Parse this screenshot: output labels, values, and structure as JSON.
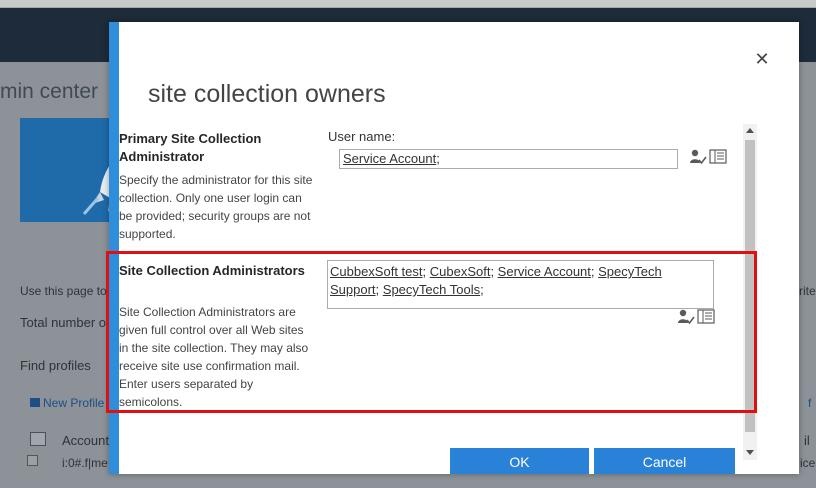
{
  "background": {
    "page_title_fragment": "min center",
    "text_use_page": "Use this page to",
    "text_total": "Total number o",
    "text_find": "Find profiles",
    "link_new_profile": "New Profile",
    "row_account": "Account",
    "row_login": "i:0#.f|me",
    "right_text_1": "rite.",
    "right_text_2": "il",
    "right_text_3": "ice",
    "right_link": "f"
  },
  "dialog": {
    "title": "site collection owners",
    "close_glyph": "✕",
    "primary_section": {
      "label": "Primary Site Collection Administrator",
      "description": "Specify the administrator for this site collection. Only one user login can be provided; security groups are not supported.",
      "field_label": "User name:",
      "value_tokens": [
        "Service Account"
      ]
    },
    "admins_section": {
      "label": "Site Collection Administrators",
      "description": "Site Collection Administrators are given full control over all Web sites in the site collection. They may also receive site use confirmation mail. Enter users separated by semicolons.",
      "value_tokens": [
        "CubbexSoft test",
        "CubexSoft",
        "Service Account",
        "SpecyTech Support",
        "SpecyTech Tools"
      ]
    },
    "buttons": {
      "ok_label": "OK",
      "cancel_label": "Cancel"
    }
  },
  "colors": {
    "accent": "#2f8ddb",
    "button": "#2a82d8",
    "highlight": "#e01010",
    "suite_bar": "#1d2b3a"
  },
  "icons": {
    "check_names": "check-names-icon",
    "browse_directory": "address-book-icon",
    "close": "close-icon"
  }
}
